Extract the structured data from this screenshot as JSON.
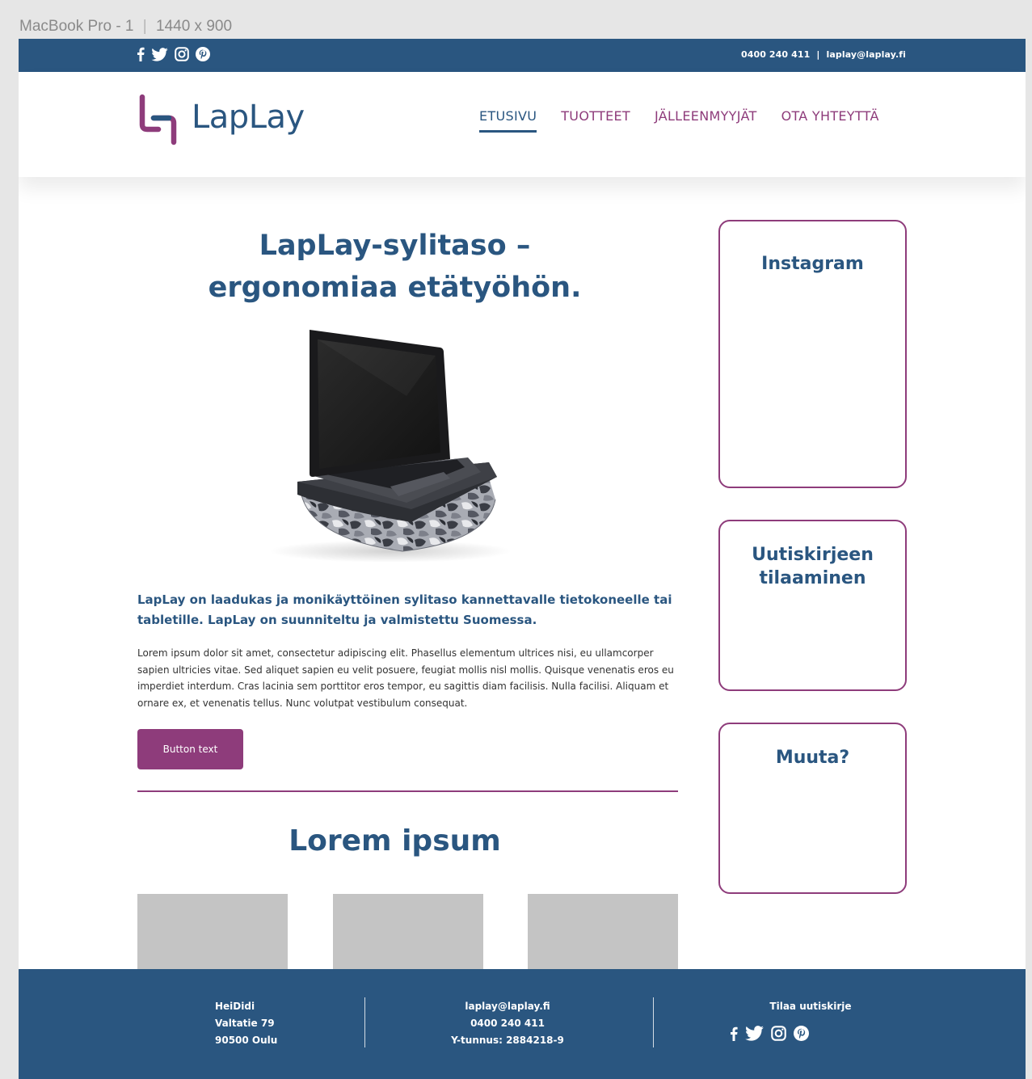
{
  "artboard": {
    "label": "MacBook Pro - 1",
    "size": "1440 x 900"
  },
  "topbar": {
    "social": [
      "facebook-icon",
      "twitter-icon",
      "instagram-icon",
      "pinterest-icon"
    ],
    "phone": "0400 240 411",
    "separator": "|",
    "email": "laplay@laplay.fi"
  },
  "header": {
    "logo_text": "LapLay",
    "nav": [
      {
        "label": "ETUSIVU",
        "active": true
      },
      {
        "label": "TUOTTEET",
        "active": false
      },
      {
        "label": "JÄLLEENMYYJÄT",
        "active": false
      },
      {
        "label": "OTA YHTEYTTÄ",
        "active": false
      }
    ]
  },
  "main": {
    "title_line1": "LapLay-sylitaso –",
    "title_line2": "ergonomiaa etätyöhön.",
    "lead": "LapLay on laadukas ja monikäyttöinen sylitaso kannettavalle tietokoneelle tai tabletille. LapLay on suunniteltu ja valmistettu Suomessa.",
    "body": "Lorem ipsum dolor sit amet, consectetur adipiscing elit. Phasellus elementum ultrices nisi, eu ullamcorper sapien ultricies vitae. Sed aliquet sapien eu velit posuere, feugiat mollis nisl mollis. Quisque venenatis eros eu imperdiet interdum. Cras lacinia sem porttitor eros tempor, eu sagittis diam facilisis. Nulla facilisi. Aliquam et ornare ex, et venenatis tellus. Nunc volutpat vestibulum consequat.",
    "button_label": "Button text",
    "section_title": "Lorem ipsum"
  },
  "sidebar": {
    "cards": [
      "Instagram",
      "Uutiskirjeen tilaaminen",
      "Muuta?"
    ]
  },
  "footer": {
    "company": "HeiDidi",
    "street": "Valtatie 79",
    "city": "90500 Oulu",
    "email": "laplay@laplay.fi",
    "phone": "0400 240 411",
    "business_id": "Y-tunnus: 2884218-9",
    "newsletter_label": "Tilaa uutiskirje"
  },
  "colors": {
    "primary": "#2a5680",
    "accent": "#8e3c7b",
    "placeholder": "#c4c4c4"
  }
}
